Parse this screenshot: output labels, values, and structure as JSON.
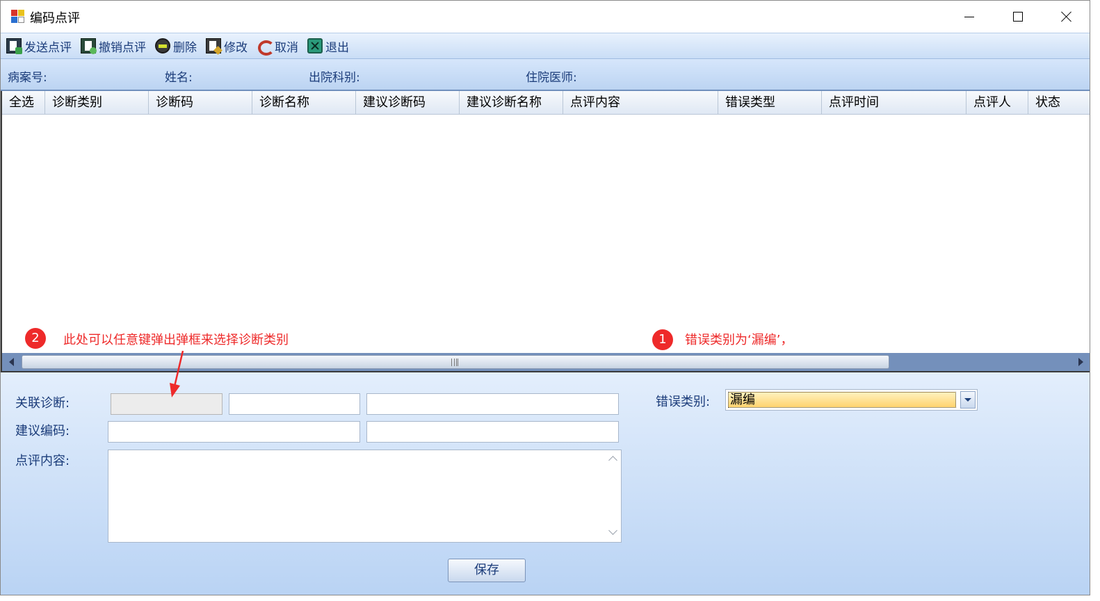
{
  "window": {
    "title": "编码点评"
  },
  "toolbar": {
    "send_review": "发送点评",
    "undo_review": "撤销点评",
    "delete": "删除",
    "modify": "修改",
    "cancel": "取消",
    "exit": "退出"
  },
  "info": {
    "case_no_label": "病案号:",
    "name_label": "姓名:",
    "dept_label": "出院科别:",
    "doctor_label": "住院医师:"
  },
  "grid": {
    "columns": [
      "全选",
      "诊断类别",
      "诊断码",
      "诊断名称",
      "建议诊断码",
      "建议诊断名称",
      "点评内容",
      "错误类型",
      "点评时间",
      "点评人",
      "状态"
    ]
  },
  "annotations": {
    "note1_number": "1",
    "note1_text": "错误类别为‘漏编’，",
    "note2_number": "2",
    "note2_text": "此处可以任意键弹出弹框来选择诊断类别"
  },
  "form": {
    "related_diag_label": "关联诊断:",
    "suggested_code_label": "建议编码:",
    "comment_label": "点评内容:",
    "error_type_label": "错误类别:",
    "error_type_value": "漏编",
    "save_label": "保存"
  },
  "colors": {
    "annotation_red": "#ee2a2a",
    "toolbar_text": "#1b3c7a",
    "selected_combo": "#ffd36e"
  }
}
